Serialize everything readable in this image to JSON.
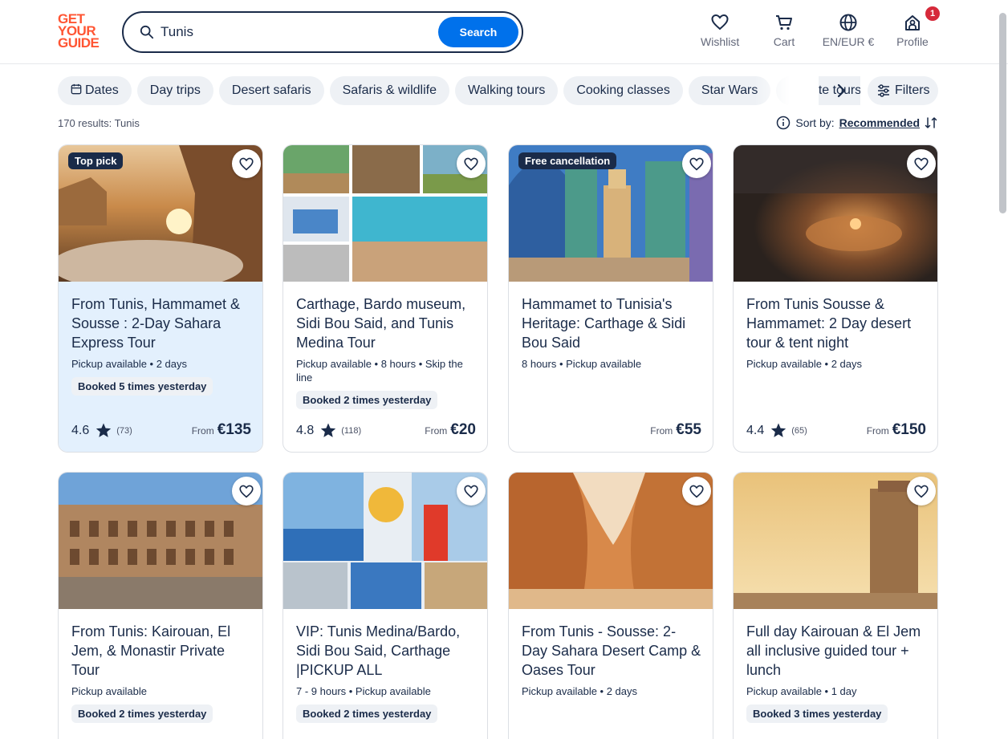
{
  "logo": {
    "line1": "GET",
    "line2": "YOUR",
    "line3": "GUIDE"
  },
  "search": {
    "value": "Tunis",
    "button": "Search"
  },
  "nav": {
    "wishlist": "Wishlist",
    "cart": "Cart",
    "lang": "EN/EUR €",
    "profile": "Profile",
    "profile_badge": "1"
  },
  "chips": [
    "Dates",
    "Day trips",
    "Desert safaris",
    "Safaris & wildlife",
    "Walking tours",
    "Cooking classes",
    "Star Wars",
    "Private tours"
  ],
  "filters_label": "Filters",
  "results_text": "170 results: Tunis",
  "sort": {
    "label": "Sort by:",
    "value": "Recommended"
  },
  "price_prefix": "From",
  "cards": [
    {
      "tag": "Top pick",
      "title": "From Tunis, Hammamet & Sousse : 2-Day Sahara Express Tour",
      "meta": "Pickup available • 2 days",
      "booked": "Booked 5 times yesterday",
      "rating": "4.6",
      "reviews": "(73)",
      "price": "€135"
    },
    {
      "tag": "",
      "title": "Carthage, Bardo museum, Sidi Bou Said, and Tunis Medina Tour",
      "meta": "Pickup available • 8 hours • Skip the line",
      "booked": "Booked 2 times yesterday",
      "rating": "4.8",
      "reviews": "(118)",
      "price": "€20"
    },
    {
      "tag": "Free cancellation",
      "title": "Hammamet to Tunisia's Heritage: Carthage & Sidi Bou Said",
      "meta": "8 hours • Pickup available",
      "booked": "",
      "rating": "",
      "reviews": "",
      "price": "€55"
    },
    {
      "tag": "",
      "title": "From Tunis Sousse & Hammamet: 2 Day desert tour & tent night",
      "meta": "Pickup available • 2 days",
      "booked": "",
      "rating": "4.4",
      "reviews": "(65)",
      "price": "€150"
    },
    {
      "tag": "",
      "title": "From Tunis: Kairouan, El Jem, & Monastir Private Tour",
      "meta": "Pickup available",
      "booked": "Booked 2 times yesterday"
    },
    {
      "tag": "",
      "title": "VIP: Tunis Medina/Bardo, Sidi Bou Said, Carthage |PICKUP ALL",
      "meta": "7 - 9 hours • Pickup available",
      "booked": "Booked 2 times yesterday"
    },
    {
      "tag": "",
      "title": "From Tunis - Sousse: 2-Day Sahara Desert Camp & Oases Tour",
      "meta": "Pickup available • 2 days",
      "booked": ""
    },
    {
      "tag": "",
      "title": "Full day Kairouan & El Jem all inclusive guided tour + lunch",
      "meta": "Pickup available • 1 day",
      "booked": "Booked 3 times yesterday"
    }
  ],
  "colors": {
    "brand": "#ff5533",
    "accent": "#0071eb",
    "navy": "#1a2b49",
    "chip_bg": "#eef1f5",
    "highlight": "#e3f0fd"
  },
  "icons": [
    "search-icon",
    "heart-icon",
    "cart-icon",
    "globe-icon",
    "profile-icon",
    "calendar-icon",
    "chevron-right-icon",
    "filter-icon",
    "info-icon",
    "sort-icon",
    "star-icon"
  ]
}
